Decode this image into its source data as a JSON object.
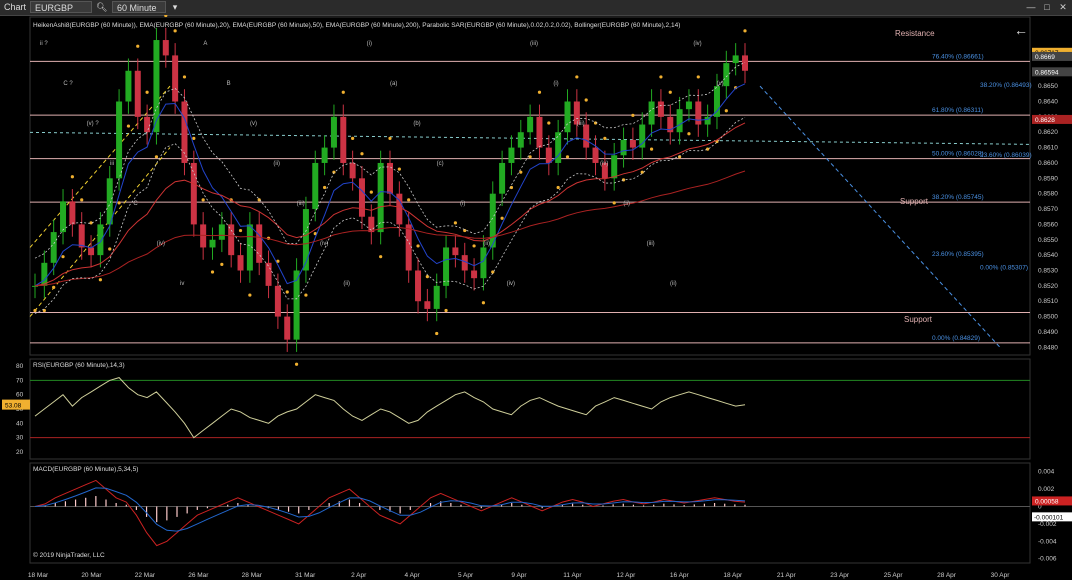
{
  "toolbar": {
    "app_label": "Chart",
    "instrument": "EURGBP",
    "timeframe": "60 Minute"
  },
  "colors": {
    "background": "#000000",
    "bull_bar": "#22aa22",
    "bear_bar": "#cc3344",
    "sar": "#f0b030",
    "ema20": "#2244cc",
    "ema50": "#cc3333",
    "ema200": "#aa2222",
    "bollinger": "#cccccc",
    "fib_text": "#4a90e2",
    "level_line": "#e0b0b0",
    "rsi_line": "#cfcf9a",
    "macd_line": "#cc2222",
    "macd_signal": "#2266cc",
    "macd_hist_pos": "#ffcccc"
  },
  "indicator_label": "HeikenAshi8(EURGBP (60 Minute)), EMA(EURGBP (60 Minute),20), EMA(EURGBP (60 Minute),50), EMA(EURGBP (60 Minute),200), Parabolic SAR(EURGBP (60 Minute),0.02,0.2,0.02), Bollinger(EURGBP (60 Minute),2,14)",
  "rsi_label": "RSI(EURGBP (60 Minute),14,3)",
  "macd_label": "MACD(EURGBP (60 Minute),5,34,5)",
  "copyright": "© 2019 NinjaTrader, LLC",
  "annotations": {
    "resistance": "Resistance",
    "support_1": "Support",
    "support_2": "Support"
  },
  "wave_labels": [
    "ii ?",
    "C ?",
    "(v) ?",
    "iii",
    "C",
    "(iv)",
    "iv",
    "A",
    "B",
    "(v)",
    "(ii)",
    "(iii)",
    "(iv)",
    "(ii)",
    "(i)",
    "(a)",
    "(b)",
    "(c)",
    "(i)",
    "(ii)",
    "(iv)",
    "(iii)",
    "(i)",
    "(iii)",
    "(iv)",
    "(ii)",
    "(iii)",
    "(ii)",
    "(iv)",
    "(v)"
  ],
  "chart_data": [
    {
      "type": "candlestick",
      "title": "",
      "x_tick_labels": [
        "18 Mar",
        "20 Mar",
        "22 Mar",
        "26 Mar",
        "28 Mar",
        "31 Mar",
        "2 Apr",
        "4 Apr",
        "5 Apr",
        "9 Apr",
        "11 Apr",
        "12 Apr",
        "16 Apr",
        "18 Apr",
        "21 Apr",
        "23 Apr",
        "25 Apr",
        "28 Apr",
        "30 Apr"
      ],
      "y_range": [
        0.8475,
        0.8695
      ],
      "y_tick_labels": [
        "0.8480",
        "0.8490",
        "0.8500",
        "0.8510",
        "0.8520",
        "0.8530",
        "0.8540",
        "0.8550",
        "0.8560",
        "0.8570",
        "0.8580",
        "0.8590",
        "0.8600",
        "0.8610",
        "0.8620",
        "0.8630",
        "0.8640",
        "0.8650"
      ],
      "price_labels": [
        {
          "value": 0.86717,
          "text": "0.86717",
          "color": "#f0b030"
        },
        {
          "value": 0.8669,
          "text": "0.8669",
          "color": "#444444"
        },
        {
          "value": 0.8659,
          "text": "0.86594",
          "color": "#444444"
        },
        {
          "value": 0.8628,
          "text": "0.8628",
          "color": "#aa2222"
        }
      ],
      "close_series": [
        0.852,
        0.8535,
        0.8555,
        0.8575,
        0.856,
        0.8545,
        0.854,
        0.856,
        0.859,
        0.864,
        0.866,
        0.863,
        0.862,
        0.868,
        0.867,
        0.864,
        0.86,
        0.856,
        0.8545,
        0.855,
        0.856,
        0.854,
        0.853,
        0.856,
        0.8535,
        0.852,
        0.85,
        0.8485,
        0.853,
        0.857,
        0.86,
        0.861,
        0.863,
        0.86,
        0.859,
        0.8565,
        0.8555,
        0.86,
        0.858,
        0.856,
        0.853,
        0.851,
        0.8505,
        0.852,
        0.8545,
        0.854,
        0.853,
        0.8525,
        0.8545,
        0.858,
        0.86,
        0.861,
        0.862,
        0.863,
        0.861,
        0.86,
        0.862,
        0.864,
        0.8625,
        0.861,
        0.86,
        0.859,
        0.8605,
        0.8615,
        0.861,
        0.8625,
        0.864,
        0.863,
        0.862,
        0.8635,
        0.864,
        0.8625,
        0.863,
        0.865,
        0.8665,
        0.867,
        0.866
      ],
      "horizontal_levels": [
        {
          "value": 0.86661,
          "label": "76.40% (0.86661)"
        },
        {
          "value": 0.86311,
          "label": "61.80% (0.86311)"
        },
        {
          "value": 0.86028,
          "label": "50.00% (0.86028)"
        },
        {
          "value": 0.85745,
          "label": "38.20% (0.85745)"
        },
        {
          "value": 0.85027,
          "label": ""
        },
        {
          "value": 0.84829,
          "label": "0.00% (0.84829)"
        }
      ],
      "fib_projection_labels": [
        {
          "value": 0.86493,
          "label": "38.20% (0.86493)"
        },
        {
          "value": 0.86039,
          "label": "23.60% (0.86039)"
        },
        {
          "value": 0.85395,
          "label": "23.60% (0.85395)"
        },
        {
          "value": 0.85307,
          "label": "0.00% (0.85307)"
        }
      ]
    },
    {
      "type": "line",
      "title": "RSI(EURGBP (60 Minute),14,3)",
      "y_range": [
        15,
        85
      ],
      "y_tick_labels": [
        "20",
        "30",
        "40",
        "50",
        "60",
        "70",
        "80"
      ],
      "levels": [
        70,
        30
      ],
      "current_label": "53.08",
      "values": [
        45,
        50,
        55,
        60,
        52,
        58,
        62,
        66,
        70,
        72,
        65,
        60,
        58,
        62,
        55,
        48,
        40,
        30,
        35,
        40,
        45,
        50,
        48,
        44,
        42,
        40,
        45,
        48,
        50,
        55,
        60,
        58,
        56,
        50,
        45,
        42,
        46,
        50,
        48,
        44,
        40,
        42,
        48,
        52,
        56,
        60,
        62,
        58,
        55,
        50,
        48,
        46,
        52,
        56,
        58,
        55,
        52,
        50,
        48,
        46,
        52,
        55,
        58,
        56,
        54,
        52,
        50,
        55,
        58,
        60,
        62,
        60,
        58,
        56,
        54,
        52,
        53
      ]
    },
    {
      "type": "line",
      "title": "MACD(EURGBP (60 Minute),5,34,5)",
      "y_range": [
        -0.0065,
        0.005
      ],
      "y_tick_labels": [
        "0.004",
        "0.002",
        "0",
        "-0.002",
        "-0.004",
        "-0.006"
      ],
      "current_labels": [
        "0.00058",
        "-0.000101"
      ],
      "macd_values": [
        0.0,
        0.0003,
        0.001,
        0.0015,
        0.002,
        0.0025,
        0.003,
        0.002,
        0.001,
        0.0005,
        -0.001,
        -0.003,
        -0.0045,
        -0.004,
        -0.003,
        -0.002,
        -0.001,
        -0.0005,
        0.0,
        0.0005,
        0.001,
        0.0005,
        0.0,
        -0.0005,
        -0.001,
        -0.0015,
        -0.002,
        -0.001,
        0.0,
        0.001,
        0.0015,
        0.002,
        0.001,
        0.0,
        -0.001,
        -0.0015,
        -0.002,
        -0.001,
        0.0,
        0.001,
        0.0015,
        0.001,
        0.0005,
        0.0,
        -0.0005,
        0.0,
        0.0005,
        0.001,
        0.0005,
        0.0,
        -0.0005,
        0.0,
        0.0005,
        0.0008,
        0.0005,
        0.0,
        0.0003,
        0.0006,
        0.0008,
        0.0005,
        0.0003,
        0.0005,
        0.0008,
        0.0006,
        0.0004,
        0.0006,
        0.0008,
        0.001,
        0.0008,
        0.0006,
        0.0005
      ]
    }
  ]
}
